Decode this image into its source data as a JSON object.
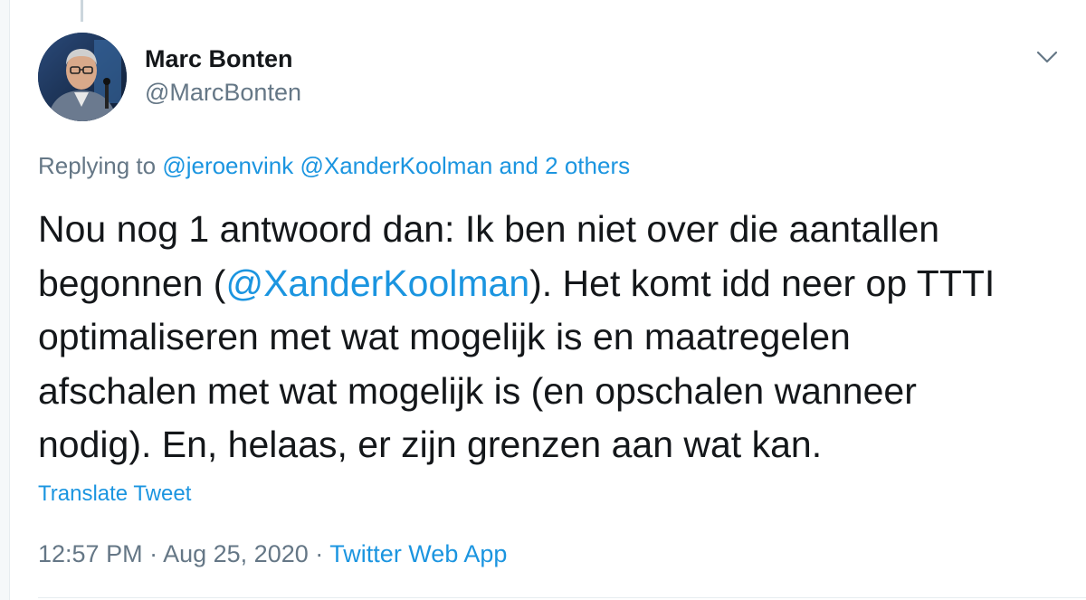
{
  "author": {
    "name": "Marc Bonten",
    "handle": "@MarcBonten"
  },
  "reply": {
    "prefix": "Replying to",
    "mention_1": "@jeroenvink",
    "mention_2": "@XanderKoolman",
    "others": "and 2 others"
  },
  "tweet": {
    "line_1": "Nou nog 1 antwoord dan: Ik ben niet over die aantallen",
    "line_2_before": "begonnen (",
    "line_2_mention": "@XanderKoolman",
    "line_2_after": "). Het komt idd neer op TTTI",
    "line_3": "optimaliseren met wat mogelijk is en maatregelen",
    "line_4": "afschalen met wat mogelijk is (en opschalen wanneer",
    "line_5": "nodig). En, helaas, er zijn grenzen aan wat kan."
  },
  "translate_label": "Translate Tweet",
  "meta": {
    "time": "12:57 PM",
    "separator": "·",
    "date": "Aug 25, 2020",
    "source": "Twitter Web App"
  },
  "colors": {
    "link": "#1b95e0",
    "secondary_text": "#657786",
    "primary_text": "#14171a"
  },
  "icons": {
    "more": "chevron-down-icon",
    "avatar": "profile-photo"
  }
}
